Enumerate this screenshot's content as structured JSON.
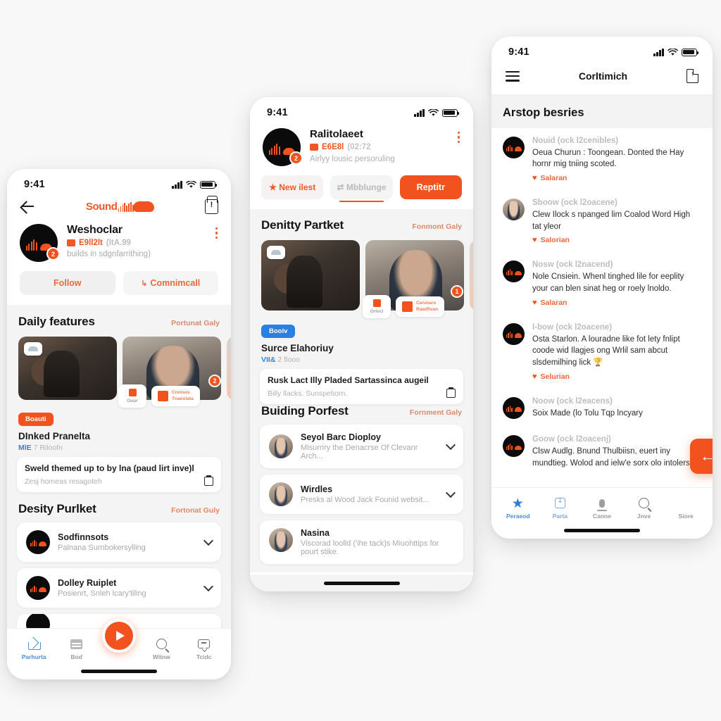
{
  "canvas": {
    "background": "#f8f8f8",
    "accent": "#f2521d",
    "blue": "#2a7fe0"
  },
  "phone1": {
    "status": {
      "time": "9:41"
    },
    "nav": {
      "back": "back-arrow",
      "logo_word": "Sound",
      "tag": "tag-icon"
    },
    "profile": {
      "name": "Weshoclar",
      "sub_text": "E9ll2lt",
      "sub_price": "(ltA.99",
      "description": "builds in sdgnfarrithing)",
      "badge": "2"
    },
    "actions": {
      "follow": "Follow",
      "comment": "Comnimcall"
    },
    "section1": {
      "title": "Daily features",
      "link": "Portunat Galy"
    },
    "featured": {
      "tag": "Boauti",
      "title": "DInked Pranelta",
      "meta_bold": "MlE",
      "meta_rest": "7 Riloofn",
      "strip_title": "Sweld themed up to by lna (paud lirt inve)l",
      "strip_sub": "Zesj homeas resagoteh",
      "chip1": "Ouur",
      "chip2_l1": "Cnnisos",
      "chip2_l2": "Tnaoolata",
      "badge": "2"
    },
    "section2": {
      "title": "Desity Purlket",
      "link": "Fortonat Guly"
    },
    "list": [
      {
        "title": "Sodfinnsots",
        "sub": "Palnana Surnbokersylling"
      },
      {
        "title": "Dolley Ruiplet",
        "sub": "Posienrt, Snleh lcary'tiling"
      }
    ],
    "tabs": [
      {
        "label": "Parhurta",
        "icon": "home-icon",
        "active": true
      },
      {
        "label": "Bod",
        "icon": "cards-icon",
        "active": false
      },
      {
        "label": "Witnw",
        "icon": "search-icon",
        "active": false
      },
      {
        "label": "Tcidc",
        "icon": "chatbox-icon",
        "active": false
      }
    ],
    "fab": "play-icon"
  },
  "phone2": {
    "status": {
      "time": "9:41"
    },
    "profile": {
      "name": "Ralitolaeet",
      "sub_text": "E6E8l",
      "sub_time": "(02:72",
      "description": "Airlyy lousic persoruling",
      "badge": "2"
    },
    "tabs": {
      "new": "New ilest",
      "middle": "Mbblunge",
      "primary": "Reptitr"
    },
    "section1": {
      "title": "Denitty Partket",
      "link": "Fonmont Galy"
    },
    "featured": {
      "tag": "Booiv",
      "title": "Surce Elahoriuy",
      "meta_bold": "VII&",
      "meta_rest": "2 flooo",
      "strip_title": "Rusk Lact Illy Pladed Sartassinca augeil",
      "strip_sub": "Billy llacks. Sunspetiorn.",
      "chip1": "Orlvcl",
      "chip2_l1": "Cenxtaro",
      "chip2_l2": "Raadfivan",
      "badge": "1"
    },
    "section2": {
      "title": "Buiding Porfest",
      "link": "Fornment Galy"
    },
    "list": [
      {
        "title": "Seyol Barc Dioploy",
        "sub": "Misurriry the Denacrse Of Clevanr Arch..."
      },
      {
        "title": "Wirdles",
        "sub": "Presks al Wood Jack Founid websit..."
      },
      {
        "title": "Nasina",
        "sub": "Viscorad loolld ('ihe tack)s Miuohttips for pourt stike."
      }
    ]
  },
  "phone3": {
    "status": {
      "time": "9:41"
    },
    "nav": {
      "title": "Corltimich",
      "menu": "hamburger-icon",
      "share": "share-icon"
    },
    "heading": "Arstop besries",
    "comments": [
      {
        "name": "Nouid",
        "meta": "(ock l2cenibles)",
        "text": "Oeua Churun : Toongean. Donted the Hay hornr mig tniing scoted.",
        "action": "Salaran",
        "avatar": "soundcloud"
      },
      {
        "name": "Sboow",
        "meta": "(ock l2oacene)",
        "text": "Clew Ilock s npanged lim Coalod Word High tat yleor",
        "action": "Salorian",
        "avatar": "photo"
      },
      {
        "name": "Nosw",
        "meta": "(ock l2nacend)",
        "text": "Nole Cnsiein. Whenl tinghed lile for eeplity your can blen sinat heg or roely lnoldo.",
        "action": "Salaran",
        "avatar": "soundcloud"
      },
      {
        "name": "I-bow",
        "meta": "(ock l2oacene)",
        "text": "Osta Starlon. A louradne like fot lety fnlipt coode wid Ilagjes ong Wrlil sam abcut slsdemilhing lick 🏆",
        "action": "Selurian",
        "avatar": "soundcloud"
      },
      {
        "name": "Noow",
        "meta": "(ock l2eacens)",
        "text": "Soix Made (lo Tolu Tqp lncyary",
        "action": "",
        "avatar": "soundcloud"
      },
      {
        "name": "Goow",
        "meta": "(ock l2oacenj)",
        "text": "Clsw Audlg. Bnund Thulbiisn, euert iny mundtieg. Wolod and ielw'e sorx olo intolers conoe avthing in to ol'eper...",
        "action": "",
        "avatar": "soundcloud"
      }
    ],
    "tabs": [
      {
        "label": "Peraeod",
        "icon": "star-icon",
        "active": true
      },
      {
        "label": "Parta",
        "icon": "square-download-icon",
        "active": false
      },
      {
        "label": "Canne",
        "icon": "mic-icon",
        "active": false
      },
      {
        "label": "Jnve",
        "icon": "search-icon",
        "active": false
      },
      {
        "label": "Siore",
        "icon": "store-icon",
        "active": false
      }
    ],
    "fab": "back-arrow-icon"
  }
}
